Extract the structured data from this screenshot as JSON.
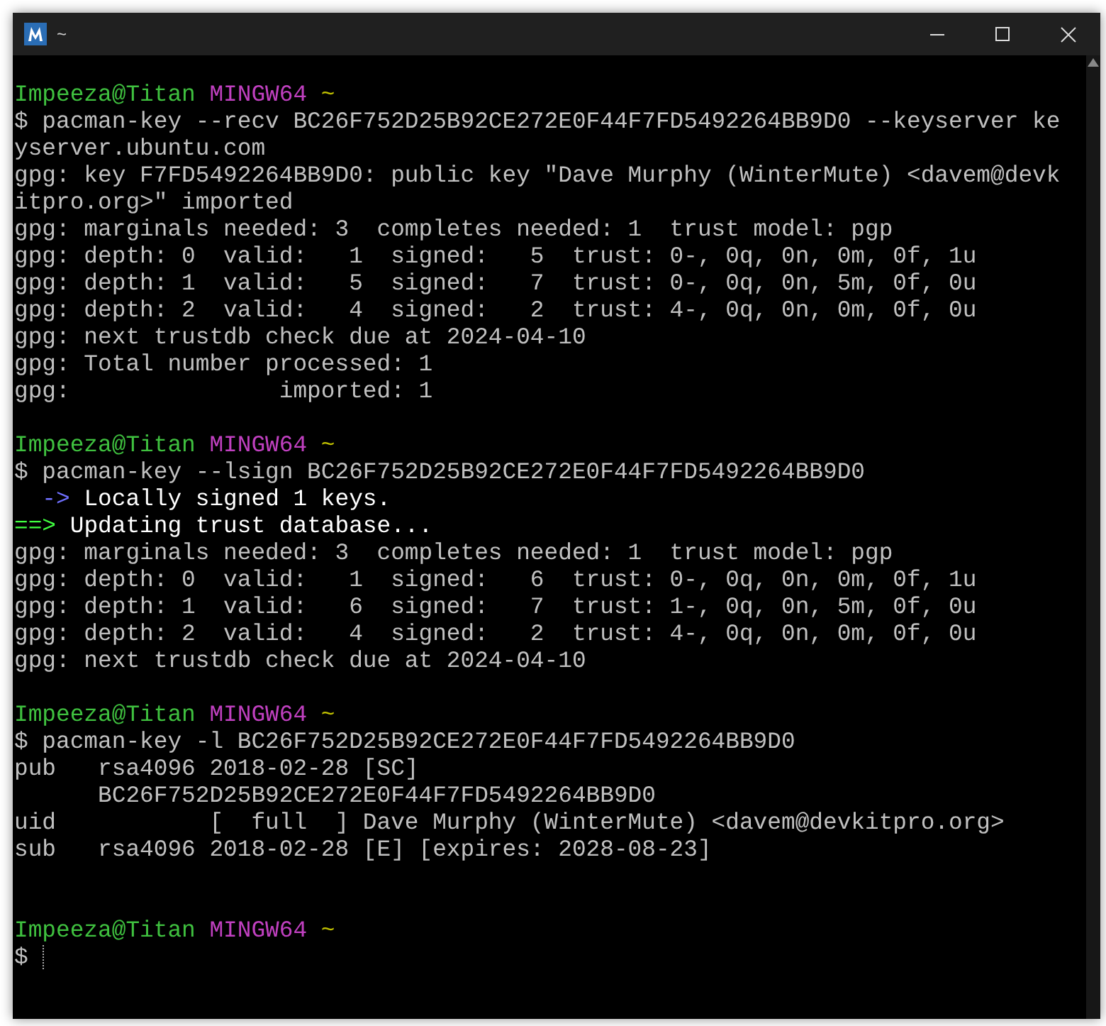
{
  "window": {
    "title": "~"
  },
  "lines": [
    {
      "kind": "prompt",
      "spans": [
        {
          "text": "Impeeza@Titan",
          "kind": "user"
        },
        {
          "text": " MINGW64",
          "kind": "shell"
        },
        {
          "text": " ~",
          "kind": "path"
        }
      ]
    },
    {
      "kind": "command",
      "spans": [
        {
          "text": "$ pacman-key --recv BC26F752D25B92CE272E0F44F7FD5492264BB9D0 --keyserver ke"
        }
      ]
    },
    {
      "kind": "command",
      "spans": [
        {
          "text": "yserver.ubuntu.com"
        }
      ]
    },
    {
      "kind": "output",
      "spans": [
        {
          "text": "gpg: key F7FD5492264BB9D0: public key \"Dave Murphy (WinterMute) <davem@devk"
        }
      ]
    },
    {
      "kind": "output",
      "spans": [
        {
          "text": "itpro.org>\" imported"
        }
      ]
    },
    {
      "kind": "output",
      "spans": [
        {
          "text": "gpg: marginals needed: 3  completes needed: 1  trust model: pgp"
        }
      ]
    },
    {
      "kind": "output",
      "spans": [
        {
          "text": "gpg: depth: 0  valid:   1  signed:   5  trust: 0-, 0q, 0n, 0m, 0f, 1u"
        }
      ]
    },
    {
      "kind": "output",
      "spans": [
        {
          "text": "gpg: depth: 1  valid:   5  signed:   7  trust: 0-, 0q, 0n, 5m, 0f, 0u"
        }
      ]
    },
    {
      "kind": "output",
      "spans": [
        {
          "text": "gpg: depth: 2  valid:   4  signed:   2  trust: 4-, 0q, 0n, 0m, 0f, 0u"
        }
      ]
    },
    {
      "kind": "output",
      "spans": [
        {
          "text": "gpg: next trustdb check due at 2024-04-10"
        }
      ]
    },
    {
      "kind": "output",
      "spans": [
        {
          "text": "gpg: Total number processed: 1"
        }
      ]
    },
    {
      "kind": "output",
      "spans": [
        {
          "text": "gpg:               imported: 1"
        }
      ]
    },
    {
      "kind": "blank"
    },
    {
      "kind": "prompt",
      "spans": [
        {
          "text": "Impeeza@Titan",
          "kind": "user"
        },
        {
          "text": " MINGW64",
          "kind": "shell"
        },
        {
          "text": " ~",
          "kind": "path"
        }
      ]
    },
    {
      "kind": "command",
      "spans": [
        {
          "text": "$ pacman-key --lsign BC26F752D25B92CE272E0F44F7FD5492264BB9D0"
        }
      ]
    },
    {
      "kind": "output",
      "spans": [
        {
          "text": "  ->",
          "kind": "arrow"
        },
        {
          "text": " Locally signed 1 keys.",
          "kind": "emph"
        }
      ]
    },
    {
      "kind": "output",
      "spans": [
        {
          "text": "==>",
          "kind": "arrow2"
        },
        {
          "text": " Updating trust database...",
          "kind": "emph"
        }
      ]
    },
    {
      "kind": "output",
      "spans": [
        {
          "text": "gpg: marginals needed: 3  completes needed: 1  trust model: pgp"
        }
      ]
    },
    {
      "kind": "output",
      "spans": [
        {
          "text": "gpg: depth: 0  valid:   1  signed:   6  trust: 0-, 0q, 0n, 0m, 0f, 1u"
        }
      ]
    },
    {
      "kind": "output",
      "spans": [
        {
          "text": "gpg: depth: 1  valid:   6  signed:   7  trust: 1-, 0q, 0n, 5m, 0f, 0u"
        }
      ]
    },
    {
      "kind": "output",
      "spans": [
        {
          "text": "gpg: depth: 2  valid:   4  signed:   2  trust: 4-, 0q, 0n, 0m, 0f, 0u"
        }
      ]
    },
    {
      "kind": "output",
      "spans": [
        {
          "text": "gpg: next trustdb check due at 2024-04-10"
        }
      ]
    },
    {
      "kind": "blank"
    },
    {
      "kind": "prompt",
      "spans": [
        {
          "text": "Impeeza@Titan",
          "kind": "user"
        },
        {
          "text": " MINGW64",
          "kind": "shell"
        },
        {
          "text": " ~",
          "kind": "path"
        }
      ]
    },
    {
      "kind": "command",
      "spans": [
        {
          "text": "$ pacman-key -l BC26F752D25B92CE272E0F44F7FD5492264BB9D0"
        }
      ]
    },
    {
      "kind": "output",
      "spans": [
        {
          "text": "pub   rsa4096 2018-02-28 [SC]"
        }
      ]
    },
    {
      "kind": "output",
      "spans": [
        {
          "text": "      BC26F752D25B92CE272E0F44F7FD5492264BB9D0"
        }
      ]
    },
    {
      "kind": "output",
      "spans": [
        {
          "text": "uid           [  full  ] Dave Murphy (WinterMute) <davem@devkitpro.org>"
        }
      ]
    },
    {
      "kind": "output",
      "spans": [
        {
          "text": "sub   rsa4096 2018-02-28 [E] [expires: 2028-08-23]"
        }
      ]
    },
    {
      "kind": "blank"
    },
    {
      "kind": "blank"
    },
    {
      "kind": "prompt",
      "spans": [
        {
          "text": "Impeeza@Titan",
          "kind": "user"
        },
        {
          "text": " MINGW64",
          "kind": "shell"
        },
        {
          "text": " ~",
          "kind": "path"
        }
      ]
    },
    {
      "kind": "input",
      "spans": [
        {
          "text": "$ "
        }
      ]
    }
  ]
}
